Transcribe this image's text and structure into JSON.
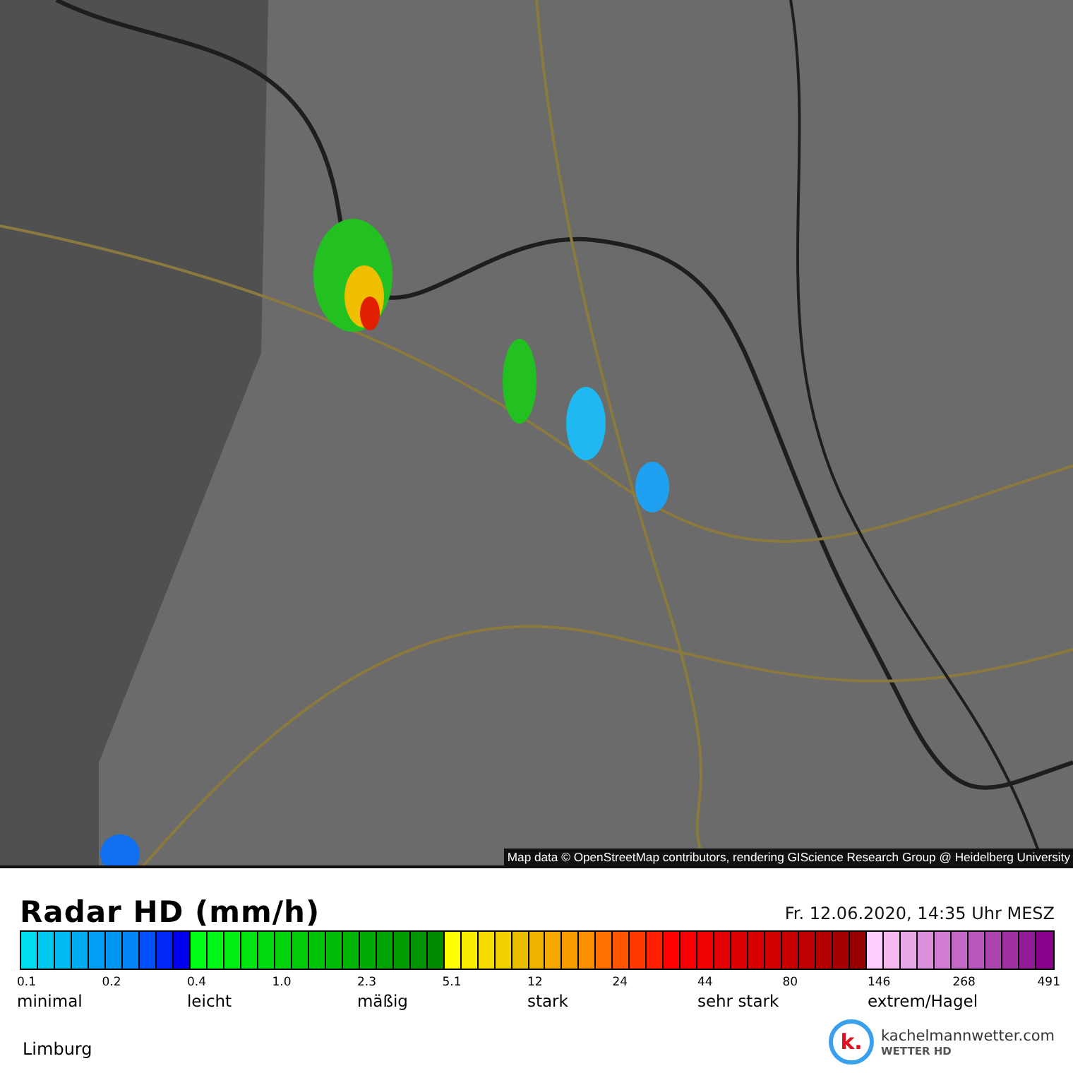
{
  "map": {
    "kind": "picture",
    "attribution": "Map data © OpenStreetMap contributors, rendering GIScience Research Group @ Heidelberg University"
  },
  "legend": {
    "title": "Radar HD (mm/h)",
    "timestamp": "Fr. 12.06.2020, 14:35 Uhr MESZ",
    "segments": [
      {
        "color": "#00dcf0"
      },
      {
        "color": "#00caf0"
      },
      {
        "color": "#00baf0"
      },
      {
        "color": "#00acf2"
      },
      {
        "color": "#009ef4"
      },
      {
        "color": "#0096f4"
      },
      {
        "color": "#0084f6"
      },
      {
        "color": "#0050fa"
      },
      {
        "color": "#0028f8"
      },
      {
        "color": "#0000f0"
      },
      {
        "color": "#00ff18"
      },
      {
        "color": "#00f818"
      },
      {
        "color": "#00ee14"
      },
      {
        "color": "#00e410"
      },
      {
        "color": "#00dc10"
      },
      {
        "color": "#00d40c"
      },
      {
        "color": "#00cc0c"
      },
      {
        "color": "#00c408"
      },
      {
        "color": "#00bc08"
      },
      {
        "color": "#00b404"
      },
      {
        "color": "#00ac04"
      },
      {
        "color": "#00a400"
      },
      {
        "color": "#009c00"
      },
      {
        "color": "#009400"
      },
      {
        "color": "#008a00"
      },
      {
        "color": "#ffff00"
      },
      {
        "color": "#f8ec00"
      },
      {
        "color": "#f4de00"
      },
      {
        "color": "#f0d000"
      },
      {
        "color": "#e8c000"
      },
      {
        "color": "#f0b400"
      },
      {
        "color": "#f4a800"
      },
      {
        "color": "#f89c00"
      },
      {
        "color": "#fc9000"
      },
      {
        "color": "#ff7000"
      },
      {
        "color": "#ff5400"
      },
      {
        "color": "#ff3800"
      },
      {
        "color": "#ff2000"
      },
      {
        "color": "#ff0000"
      },
      {
        "color": "#f80000"
      },
      {
        "color": "#f00000"
      },
      {
        "color": "#e60000"
      },
      {
        "color": "#de0000"
      },
      {
        "color": "#d80000"
      },
      {
        "color": "#d20000"
      },
      {
        "color": "#c80000"
      },
      {
        "color": "#be0000"
      },
      {
        "color": "#b40000"
      },
      {
        "color": "#a80000"
      },
      {
        "color": "#980000"
      },
      {
        "color": "#ffccff"
      },
      {
        "color": "#f4b8f0"
      },
      {
        "color": "#e8a8e8"
      },
      {
        "color": "#dc90dc"
      },
      {
        "color": "#d07cd4"
      },
      {
        "color": "#c468c8"
      },
      {
        "color": "#b858bc"
      },
      {
        "color": "#ac44b0"
      },
      {
        "color": "#a030a4"
      },
      {
        "color": "#941c98"
      },
      {
        "color": "#88008c"
      }
    ],
    "ticks": [
      "0.1",
      "0.2",
      "0.4",
      "1.0",
      "2.3",
      "5.1",
      "12",
      "24",
      "44",
      "80",
      "146",
      "268",
      "491"
    ],
    "categories": [
      "minimal",
      "leicht",
      "mäßig",
      "stark",
      "sehr stark",
      "extrem/Hagel"
    ]
  },
  "region": "Limburg",
  "logo": {
    "letter": "k.",
    "name": "kachelmannwetter.com",
    "subtitle": "WETTER HD"
  }
}
